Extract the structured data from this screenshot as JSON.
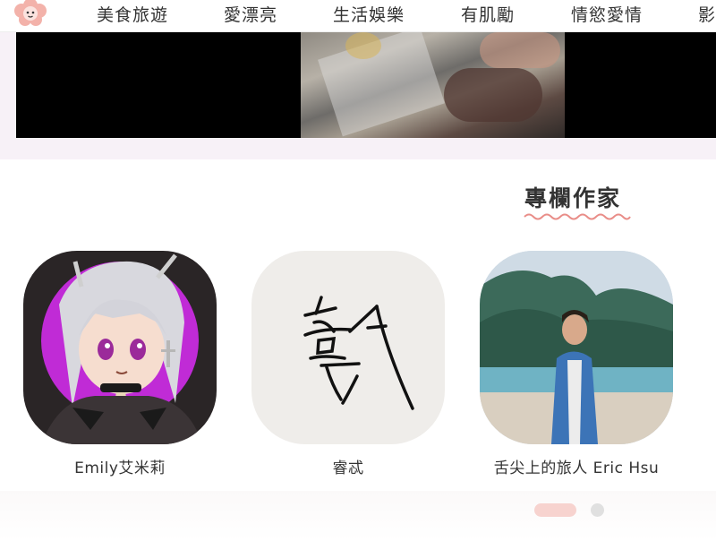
{
  "nav": {
    "items": [
      {
        "label": "美食旅遊"
      },
      {
        "label": "愛漂亮"
      },
      {
        "label": "生活娛樂"
      },
      {
        "label": "有肌勵"
      },
      {
        "label": "情慾愛情"
      },
      {
        "label": "影"
      }
    ]
  },
  "section": {
    "title": "專欄作家"
  },
  "columnists": [
    {
      "name": "Emily艾米莉"
    },
    {
      "name": "睿忒"
    },
    {
      "name": "舌尖上的旅人 Eric Hsu"
    }
  ],
  "pager": {
    "active_index": 0,
    "page_count": 2
  },
  "colors": {
    "accent": "#e98d88",
    "pager_active": "#f7d3cf",
    "pager_inactive": "#e0e0e0",
    "video_bg": "#000000"
  }
}
